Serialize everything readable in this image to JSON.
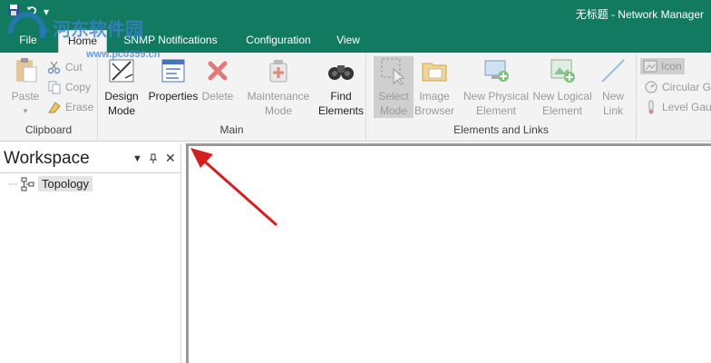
{
  "window": {
    "title": "无标题 - Network Manager"
  },
  "tabs": [
    {
      "label": "File"
    },
    {
      "label": "Home"
    },
    {
      "label": "SNMP Notifications"
    },
    {
      "label": "Configuration"
    },
    {
      "label": "View"
    }
  ],
  "ribbon": {
    "clipboard": {
      "label": "Clipboard",
      "paste": "Paste",
      "cut": "Cut",
      "copy": "Copy",
      "erase": "Erase"
    },
    "main": {
      "label": "Main",
      "design_mode": "Design Mode",
      "properties": "Properties",
      "delete": "Delete",
      "maintenance_mode": "Maintenance Mode",
      "find_elements": "Find Elements"
    },
    "elements_links": {
      "label": "Elements and Links",
      "select_mode": "Select Mode",
      "image_browser": "Image Browser",
      "new_physical": "New Physical Element",
      "new_logical": "New Logical Element",
      "new_link": "New Link"
    },
    "gauges": {
      "icon": "Icon",
      "circular": "Circular Ga",
      "level": "Level Gaug"
    }
  },
  "workspace": {
    "title": "Workspace",
    "tree": [
      {
        "label": "Topology"
      }
    ]
  },
  "watermark": {
    "line1": "河东软件园",
    "line2": "www.pc0359.cn"
  },
  "colors": {
    "title_bar": "#137a62",
    "ribbon_bg": "#f3f3f3",
    "arrow": "#d42020"
  }
}
